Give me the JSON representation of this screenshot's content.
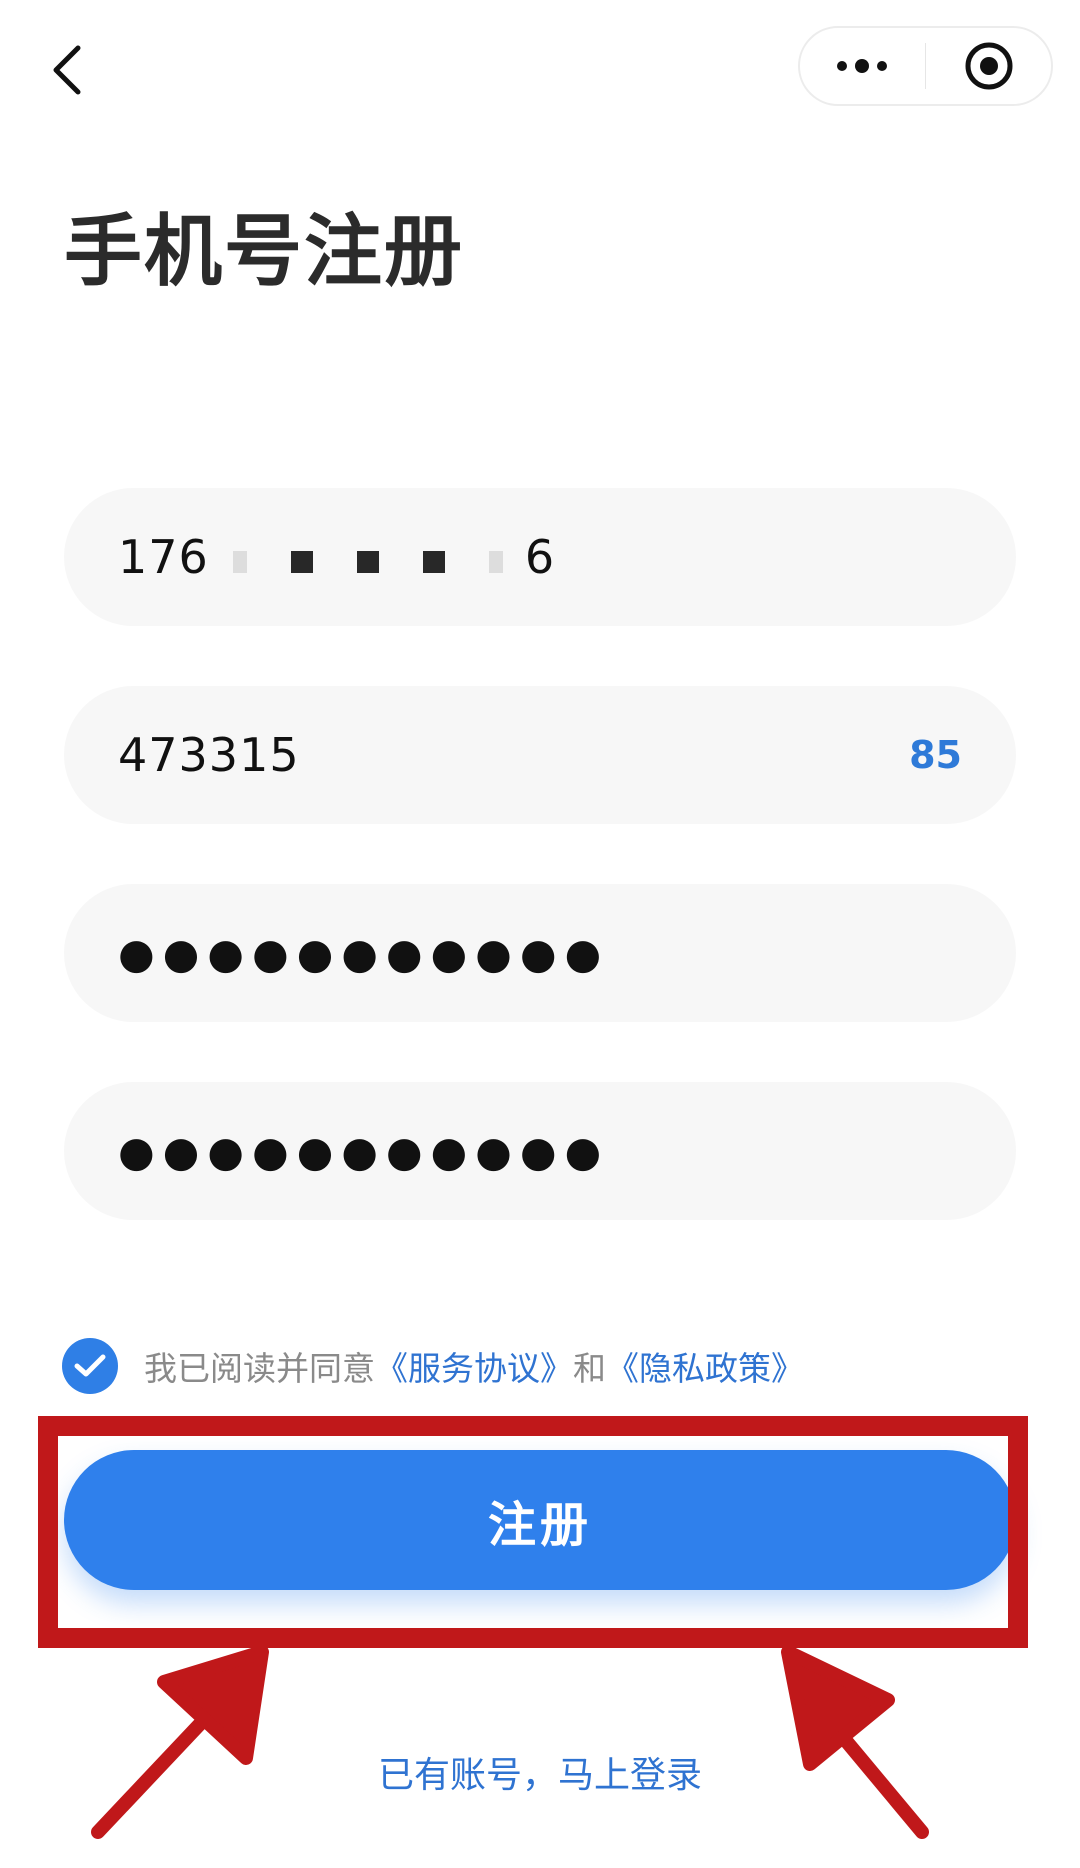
{
  "header": {
    "back_icon": "chevron-left-icon",
    "more_icon": "more-dots-icon",
    "close_icon": "target-circle-icon"
  },
  "page": {
    "title": "手机号注册"
  },
  "form": {
    "phone": {
      "prefix": "176",
      "suffix": "6"
    },
    "code": {
      "value": "473315",
      "countdown": "85"
    },
    "password": {
      "value": "●●●●●●●●●●●"
    },
    "confirm_password": {
      "value": "●●●●●●●●●●●"
    }
  },
  "agreement": {
    "checked": true,
    "text": "我已阅读并同意",
    "service_link": "《服务协议》",
    "and": "和",
    "privacy_link": "《隐私政策》"
  },
  "actions": {
    "register_label": "注册",
    "login_link": "已有账号，马上登录"
  },
  "colors": {
    "accent": "#2f80ec",
    "link": "#2f73d1",
    "highlight": "#c0181a"
  }
}
